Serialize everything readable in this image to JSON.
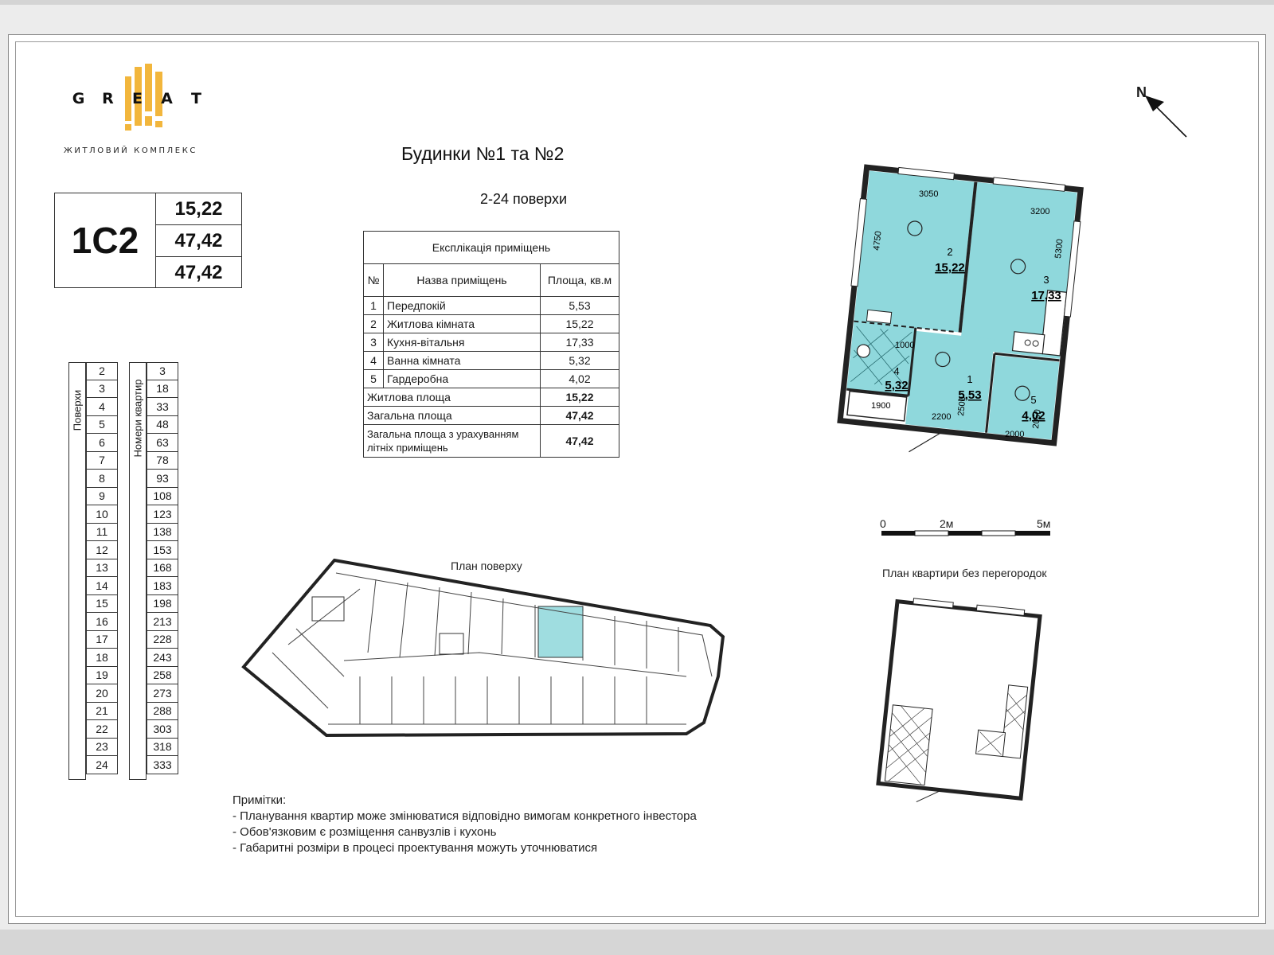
{
  "brand": {
    "letters": [
      "G",
      "R",
      "E",
      "A",
      "T"
    ],
    "subtitle": "ЖИТЛОВИЙ КОМПЛЕКС"
  },
  "apartment": {
    "code": "1С2",
    "values": [
      "15,22",
      "47,42",
      "47,42"
    ]
  },
  "headings": {
    "buildings": "Будинки №1 та №2",
    "floors_range": "2-24 поверхи"
  },
  "explication": {
    "title": "Експлікація приміщень",
    "col_num": "№",
    "col_name": "Назва приміщень",
    "col_area": "Площа, кв.м",
    "rows": [
      {
        "num": "1",
        "name": "Передпокій",
        "area": "5,53"
      },
      {
        "num": "2",
        "name": "Житлова кімната",
        "area": "15,22"
      },
      {
        "num": "3",
        "name": "Кухня-вітальня",
        "area": "17,33"
      },
      {
        "num": "4",
        "name": "Ванна кімната",
        "area": "5,32"
      },
      {
        "num": "5",
        "name": "Гардеробна",
        "area": "4,02"
      }
    ],
    "living_label": "Житлова площа",
    "living_value": "15,22",
    "total_label": "Загальна площа",
    "total_value": "47,42",
    "total_summer_label": "Загальна площа з урахуванням літніх приміщень",
    "total_summer_value": "47,42"
  },
  "floors_table": {
    "floors_label": "Поверхи",
    "apts_label": "Номери квартир",
    "floors": [
      "2",
      "3",
      "4",
      "5",
      "6",
      "7",
      "8",
      "9",
      "10",
      "11",
      "12",
      "13",
      "14",
      "15",
      "16",
      "17",
      "18",
      "19",
      "20",
      "21",
      "22",
      "23",
      "24"
    ],
    "apartments": [
      "3",
      "18",
      "33",
      "48",
      "63",
      "78",
      "93",
      "108",
      "123",
      "138",
      "153",
      "168",
      "183",
      "198",
      "213",
      "228",
      "243",
      "258",
      "273",
      "288",
      "303",
      "318",
      "333"
    ]
  },
  "plan": {
    "north": "N",
    "rooms": [
      {
        "num": "1",
        "area": "5,53"
      },
      {
        "num": "2",
        "area": "15,22"
      },
      {
        "num": "3",
        "area": "17,33"
      },
      {
        "num": "4",
        "area": "5,32"
      },
      {
        "num": "5",
        "area": "4,02"
      }
    ],
    "dims": [
      "3050",
      "3200",
      "4750",
      "5300",
      "1900",
      "2200",
      "2500",
      "2000",
      "2050",
      "1000"
    ],
    "scale_labels": [
      "0",
      "2м",
      "5м"
    ],
    "no_partitions_label": "План квартири без перегородок",
    "floor_plan_label": "План поверху"
  },
  "notes": {
    "title": "Примітки:",
    "items": [
      "- Планування квартир може змінюватися відповідно вимогам конкретного інвестора",
      "- Обов'язковим є розміщення санвузлів і кухонь",
      "- Габаритні розміри в процесі проектування можуть уточнюватися"
    ]
  },
  "colors": {
    "accent_gold": "#f2b63c",
    "plan_fill": "#8fd8dc",
    "highlight_fill": "#9fdde0"
  }
}
